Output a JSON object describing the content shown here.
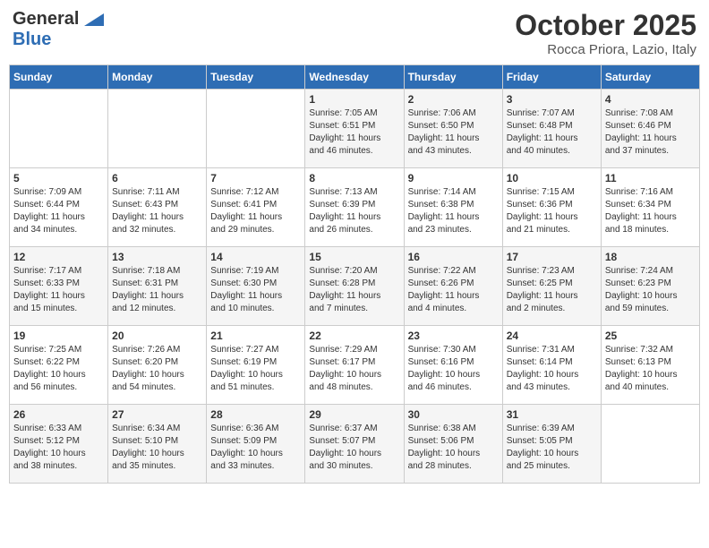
{
  "header": {
    "logo_line1": "General",
    "logo_line2": "Blue",
    "month": "October 2025",
    "location": "Rocca Priora, Lazio, Italy"
  },
  "weekdays": [
    "Sunday",
    "Monday",
    "Tuesday",
    "Wednesday",
    "Thursday",
    "Friday",
    "Saturday"
  ],
  "weeks": [
    [
      {
        "day": "",
        "info": ""
      },
      {
        "day": "",
        "info": ""
      },
      {
        "day": "",
        "info": ""
      },
      {
        "day": "1",
        "info": "Sunrise: 7:05 AM\nSunset: 6:51 PM\nDaylight: 11 hours\nand 46 minutes."
      },
      {
        "day": "2",
        "info": "Sunrise: 7:06 AM\nSunset: 6:50 PM\nDaylight: 11 hours\nand 43 minutes."
      },
      {
        "day": "3",
        "info": "Sunrise: 7:07 AM\nSunset: 6:48 PM\nDaylight: 11 hours\nand 40 minutes."
      },
      {
        "day": "4",
        "info": "Sunrise: 7:08 AM\nSunset: 6:46 PM\nDaylight: 11 hours\nand 37 minutes."
      }
    ],
    [
      {
        "day": "5",
        "info": "Sunrise: 7:09 AM\nSunset: 6:44 PM\nDaylight: 11 hours\nand 34 minutes."
      },
      {
        "day": "6",
        "info": "Sunrise: 7:11 AM\nSunset: 6:43 PM\nDaylight: 11 hours\nand 32 minutes."
      },
      {
        "day": "7",
        "info": "Sunrise: 7:12 AM\nSunset: 6:41 PM\nDaylight: 11 hours\nand 29 minutes."
      },
      {
        "day": "8",
        "info": "Sunrise: 7:13 AM\nSunset: 6:39 PM\nDaylight: 11 hours\nand 26 minutes."
      },
      {
        "day": "9",
        "info": "Sunrise: 7:14 AM\nSunset: 6:38 PM\nDaylight: 11 hours\nand 23 minutes."
      },
      {
        "day": "10",
        "info": "Sunrise: 7:15 AM\nSunset: 6:36 PM\nDaylight: 11 hours\nand 21 minutes."
      },
      {
        "day": "11",
        "info": "Sunrise: 7:16 AM\nSunset: 6:34 PM\nDaylight: 11 hours\nand 18 minutes."
      }
    ],
    [
      {
        "day": "12",
        "info": "Sunrise: 7:17 AM\nSunset: 6:33 PM\nDaylight: 11 hours\nand 15 minutes."
      },
      {
        "day": "13",
        "info": "Sunrise: 7:18 AM\nSunset: 6:31 PM\nDaylight: 11 hours\nand 12 minutes."
      },
      {
        "day": "14",
        "info": "Sunrise: 7:19 AM\nSunset: 6:30 PM\nDaylight: 11 hours\nand 10 minutes."
      },
      {
        "day": "15",
        "info": "Sunrise: 7:20 AM\nSunset: 6:28 PM\nDaylight: 11 hours\nand 7 minutes."
      },
      {
        "day": "16",
        "info": "Sunrise: 7:22 AM\nSunset: 6:26 PM\nDaylight: 11 hours\nand 4 minutes."
      },
      {
        "day": "17",
        "info": "Sunrise: 7:23 AM\nSunset: 6:25 PM\nDaylight: 11 hours\nand 2 minutes."
      },
      {
        "day": "18",
        "info": "Sunrise: 7:24 AM\nSunset: 6:23 PM\nDaylight: 10 hours\nand 59 minutes."
      }
    ],
    [
      {
        "day": "19",
        "info": "Sunrise: 7:25 AM\nSunset: 6:22 PM\nDaylight: 10 hours\nand 56 minutes."
      },
      {
        "day": "20",
        "info": "Sunrise: 7:26 AM\nSunset: 6:20 PM\nDaylight: 10 hours\nand 54 minutes."
      },
      {
        "day": "21",
        "info": "Sunrise: 7:27 AM\nSunset: 6:19 PM\nDaylight: 10 hours\nand 51 minutes."
      },
      {
        "day": "22",
        "info": "Sunrise: 7:29 AM\nSunset: 6:17 PM\nDaylight: 10 hours\nand 48 minutes."
      },
      {
        "day": "23",
        "info": "Sunrise: 7:30 AM\nSunset: 6:16 PM\nDaylight: 10 hours\nand 46 minutes."
      },
      {
        "day": "24",
        "info": "Sunrise: 7:31 AM\nSunset: 6:14 PM\nDaylight: 10 hours\nand 43 minutes."
      },
      {
        "day": "25",
        "info": "Sunrise: 7:32 AM\nSunset: 6:13 PM\nDaylight: 10 hours\nand 40 minutes."
      }
    ],
    [
      {
        "day": "26",
        "info": "Sunrise: 6:33 AM\nSunset: 5:12 PM\nDaylight: 10 hours\nand 38 minutes."
      },
      {
        "day": "27",
        "info": "Sunrise: 6:34 AM\nSunset: 5:10 PM\nDaylight: 10 hours\nand 35 minutes."
      },
      {
        "day": "28",
        "info": "Sunrise: 6:36 AM\nSunset: 5:09 PM\nDaylight: 10 hours\nand 33 minutes."
      },
      {
        "day": "29",
        "info": "Sunrise: 6:37 AM\nSunset: 5:07 PM\nDaylight: 10 hours\nand 30 minutes."
      },
      {
        "day": "30",
        "info": "Sunrise: 6:38 AM\nSunset: 5:06 PM\nDaylight: 10 hours\nand 28 minutes."
      },
      {
        "day": "31",
        "info": "Sunrise: 6:39 AM\nSunset: 5:05 PM\nDaylight: 10 hours\nand 25 minutes."
      },
      {
        "day": "",
        "info": ""
      }
    ]
  ]
}
